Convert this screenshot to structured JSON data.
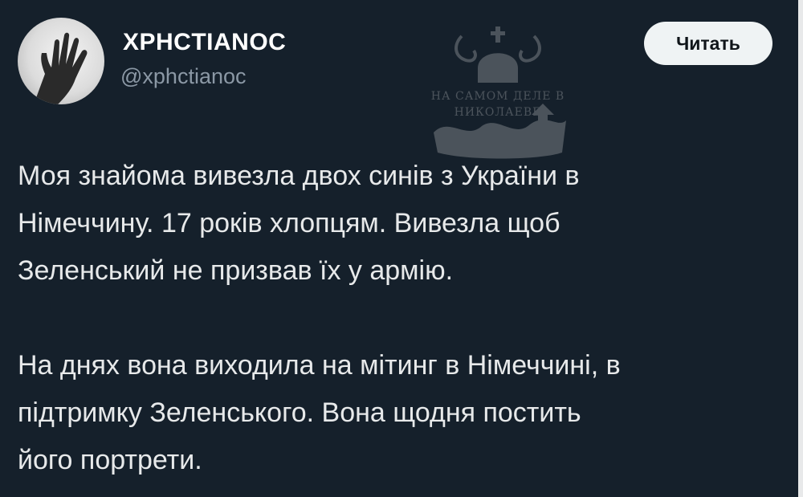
{
  "author": {
    "display_name": "XPHCTIANOC",
    "handle": "@xphctianoc",
    "avatar_icon": "raised-hand-avatar-icon"
  },
  "follow_button": {
    "label": "Читать"
  },
  "watermark": {
    "line1": "НА САМОМ ДЕЛЕ В",
    "line2": "НИКОЛАЕВЕ",
    "icon": "coat-of-arms-watermark-icon"
  },
  "tweet": {
    "paragraphs": [
      "Моя знайома вивезла двох синів з України в\nНімеччину. 17 років хлопцям. Вивезла щоб\nЗеленський не призвав їх у армію.",
      "На днях вона виходила на мітинг в Німеччині, в\nпідтримку Зеленського. Вона щодня постить\nйого портрети."
    ]
  },
  "colors": {
    "background": "#15202b",
    "text": "#e7e9ea",
    "secondary_text": "#8b98a5",
    "button_bg": "#eff3f4",
    "button_text": "#0f1419"
  }
}
